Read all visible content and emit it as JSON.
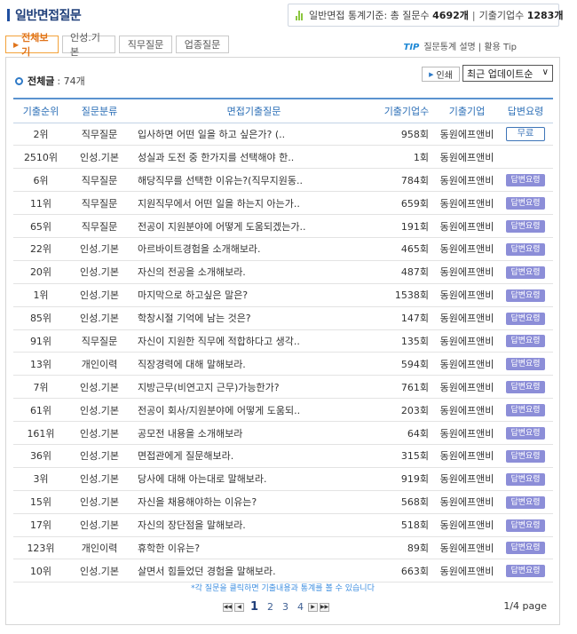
{
  "header": {
    "title": "일반면접질문",
    "stats_prefix": "일반면접 통계기준: 총 질문수",
    "total_questions": "4692개",
    "companies_label": "기출기업수",
    "total_companies": "1283개"
  },
  "tabs": [
    {
      "label": "전체보기",
      "active": true
    },
    {
      "label": "인성.기본",
      "active": false
    },
    {
      "label": "직무질문",
      "active": false
    },
    {
      "label": "업종질문",
      "active": false
    }
  ],
  "tip": {
    "label": "TIP",
    "text": "질문통계 설명 | 활용 Tip"
  },
  "list": {
    "total_label": "전체글",
    "total_value": ": 74개",
    "print_label": "인쇄",
    "sort_value": "최근 업데이트순"
  },
  "table": {
    "headers": [
      "기출순위",
      "질문분류",
      "면접기출질문",
      "기출기업수",
      "기출기업",
      "답변요령"
    ],
    "rows": [
      {
        "rank": "2위",
        "category": "직무질문",
        "question": "입사하면 어떤 일을 하고 싶은가? (..",
        "count": "958회",
        "company": "동원에프앤비",
        "answer": "무료"
      },
      {
        "rank": "2510위",
        "category": "인성.기본",
        "question": "성실과 도전 중 한가지를 선택해야 한..",
        "count": "1회",
        "company": "동원에프앤비",
        "answer": ""
      },
      {
        "rank": "6위",
        "category": "직무질문",
        "question": "해당직무를 선택한 이유는?(직무지원동..",
        "count": "784회",
        "company": "동원에프앤비",
        "answer": "답변요령"
      },
      {
        "rank": "11위",
        "category": "직무질문",
        "question": "지원직무에서 어떤 일을 하는지 아는가..",
        "count": "659회",
        "company": "동원에프앤비",
        "answer": "답변요령"
      },
      {
        "rank": "65위",
        "category": "직무질문",
        "question": "전공이 지원분야에 어떻게 도움되겠는가..",
        "count": "191회",
        "company": "동원에프앤비",
        "answer": "답변요령"
      },
      {
        "rank": "22위",
        "category": "인성.기본",
        "question": "아르바이트경험을 소개해보라.",
        "count": "465회",
        "company": "동원에프앤비",
        "answer": "답변요령"
      },
      {
        "rank": "20위",
        "category": "인성.기본",
        "question": "자신의 전공을 소개해보라.",
        "count": "487회",
        "company": "동원에프앤비",
        "answer": "답변요령"
      },
      {
        "rank": "1위",
        "category": "인성.기본",
        "question": "마지막으로 하고싶은 말은?",
        "count": "1538회",
        "company": "동원에프앤비",
        "answer": "답변요령"
      },
      {
        "rank": "85위",
        "category": "인성.기본",
        "question": "학창시절 기억에 남는 것은?",
        "count": "147회",
        "company": "동원에프앤비",
        "answer": "답변요령"
      },
      {
        "rank": "91위",
        "category": "직무질문",
        "question": "자신이 지원한 직무에 적합하다고 생각..",
        "count": "135회",
        "company": "동원에프앤비",
        "answer": "답변요령"
      },
      {
        "rank": "13위",
        "category": "개인이력",
        "question": "직장경력에 대해 말해보라.",
        "count": "594회",
        "company": "동원에프앤비",
        "answer": "답변요령"
      },
      {
        "rank": "7위",
        "category": "인성.기본",
        "question": "지방근무(비연고지 근무)가능한가?",
        "count": "761회",
        "company": "동원에프앤비",
        "answer": "답변요령"
      },
      {
        "rank": "61위",
        "category": "인성.기본",
        "question": "전공이 회사/지원분야에 어떻게 도움되..",
        "count": "203회",
        "company": "동원에프앤비",
        "answer": "답변요령"
      },
      {
        "rank": "161위",
        "category": "인성.기본",
        "question": "공모전 내용을 소개해보라",
        "count": "64회",
        "company": "동원에프앤비",
        "answer": "답변요령"
      },
      {
        "rank": "36위",
        "category": "인성.기본",
        "question": "면접관에게 질문해보라.",
        "count": "315회",
        "company": "동원에프앤비",
        "answer": "답변요령"
      },
      {
        "rank": "3위",
        "category": "인성.기본",
        "question": "당사에 대해 아는대로 말해보라.",
        "count": "919회",
        "company": "동원에프앤비",
        "answer": "답변요령"
      },
      {
        "rank": "15위",
        "category": "인성.기본",
        "question": "자신을 채용해야하는 이유는?",
        "count": "568회",
        "company": "동원에프앤비",
        "answer": "답변요령"
      },
      {
        "rank": "17위",
        "category": "인성.기본",
        "question": "자신의 장단점을 말해보라.",
        "count": "518회",
        "company": "동원에프앤비",
        "answer": "답변요령"
      },
      {
        "rank": "123위",
        "category": "개인이력",
        "question": "휴학한 이유는?",
        "count": "89회",
        "company": "동원에프앤비",
        "answer": "답변요령"
      },
      {
        "rank": "10위",
        "category": "인성.기본",
        "question": "살면서 힘들었던 경험을 말해보라.",
        "count": "663회",
        "company": "동원에프앤비",
        "answer": "답변요령"
      }
    ]
  },
  "note": "*각 질문을 클릭하면 기출내용과 통계를 볼 수 있습니다",
  "pagination": {
    "pages": [
      "1",
      "2",
      "3",
      "4"
    ],
    "current": "1",
    "info": "1/4 page",
    "first": "◀◀",
    "prev": "◀",
    "next": "▶",
    "last": "▶▶"
  },
  "colors": {
    "accent_blue": "#2c6fb7",
    "tab_orange": "#e0741b",
    "badge_purple": "#8c8ed8",
    "stats_green": "#8cc63f"
  }
}
